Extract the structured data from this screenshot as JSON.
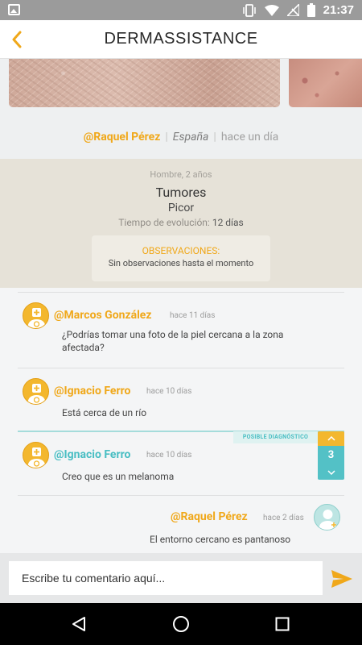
{
  "status_bar": {
    "time": "21:37"
  },
  "header": {
    "title": "DERMASSISTANCE"
  },
  "post": {
    "author": "@Raquel Pérez",
    "country": "España",
    "time_ago": "hace un día"
  },
  "case": {
    "demographics": "Hombre, 2 años",
    "diagnosis": "Tumores",
    "symptom": "Picor",
    "evolution_label": "Tiempo de evolución:",
    "evolution_value": "12 días",
    "observations_title": "OBSERVACIONES:",
    "observations_text": "Sin observaciones hasta el momento"
  },
  "comments": [
    {
      "author": "@Marcos González",
      "time": "hace 11 días",
      "text": "¿Podrías tomar una foto de la piel cercana a la zona afectada?",
      "role": "doctor"
    },
    {
      "author": "@Ignacio Ferro",
      "time": "hace 10 días",
      "text": "Está cerca de un río",
      "role": "doctor"
    },
    {
      "author": "@Ignacio Ferro",
      "time": "hace 10 días",
      "text": "Creo que es un melanoma",
      "role": "doctor",
      "tag": "POSIBLE DIAGNÓSTICO",
      "votes": "3"
    },
    {
      "author": "@Raquel Pérez",
      "time": "hace 2 días",
      "text": "El entorno cercano es pantanoso",
      "role": "patient"
    }
  ],
  "input": {
    "placeholder": "Escribe tu comentario aquí..."
  },
  "colors": {
    "accent": "#f0a81a",
    "teal": "#49bec3",
    "case_bg": "#e6e2d8"
  }
}
